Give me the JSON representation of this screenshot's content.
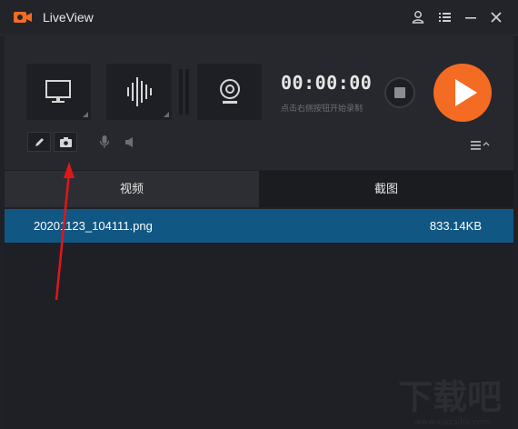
{
  "app": {
    "title": "LiveView"
  },
  "recorder": {
    "timer": "00:00:00",
    "hint": "点击右侧按钮开始录制"
  },
  "tabs": [
    {
      "label": "视频",
      "active": false
    },
    {
      "label": "截图",
      "active": true
    }
  ],
  "files": [
    {
      "name": "20201123_104111.png",
      "size": "833.14KB",
      "selected": true
    }
  ],
  "colors": {
    "accent": "#f46b23",
    "selection": "#115784",
    "annotation_arrow": "#e0161b"
  },
  "watermark": {
    "text": "下载吧",
    "url_text": "www.xiazaiba.com"
  }
}
